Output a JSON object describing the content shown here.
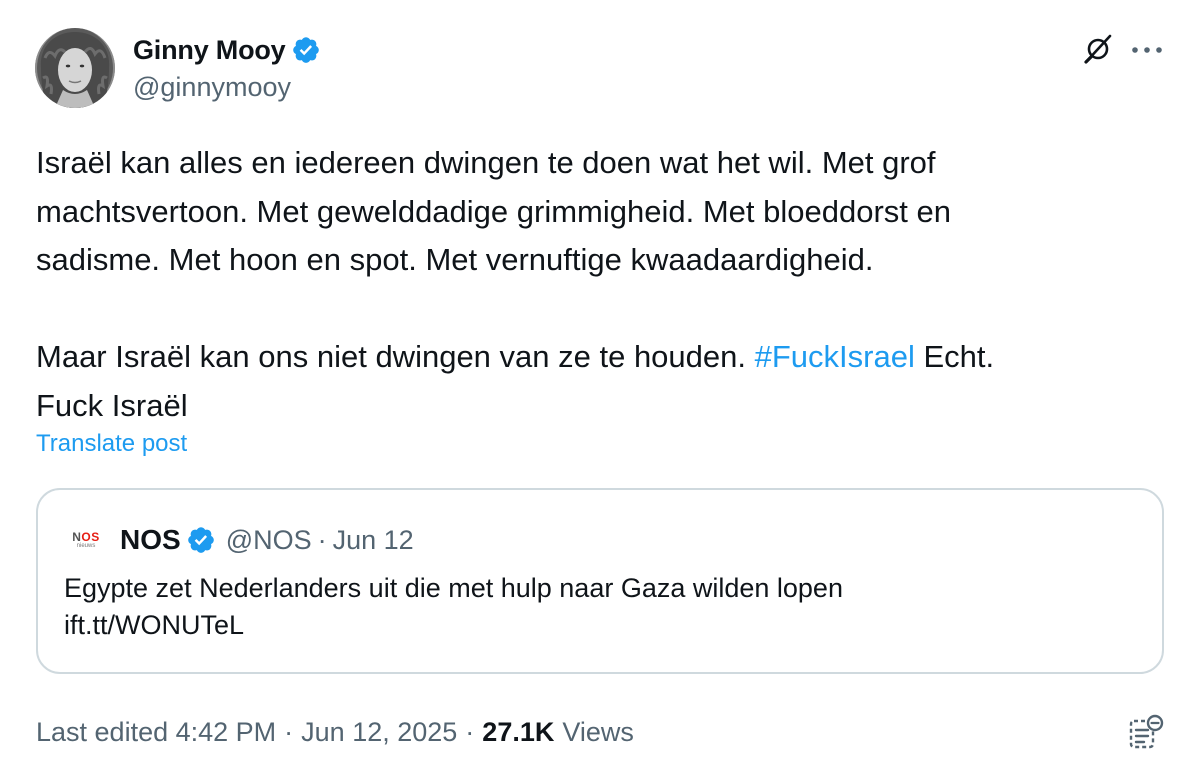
{
  "author": {
    "name": "Ginny Mooy",
    "handle": "@ginnymooy"
  },
  "post": {
    "line1": "Israël kan alles en iedereen dwingen te doen wat het wil. Met grof",
    "line2": "machtsvertoon. Met gewelddadige grimmigheid. Met bloeddorst en",
    "line3": "sadisme. Met hoon en spot. Met vernuftige kwaadaardigheid.",
    "line4_before": "Maar Israël kan ons niet dwingen van ze te houden. ",
    "hashtag": "#FuckIsrael",
    "line4_after": " Echt.",
    "line5": "Fuck Israël"
  },
  "translate_label": "Translate post",
  "quote": {
    "logo_text_main_part1": "N",
    "logo_text_main_part2": "OS",
    "logo_text_sub": "nieuws",
    "name": "NOS",
    "handle": "@NOS",
    "separator": "·",
    "date": "Jun 12",
    "line1": "Egypte zet Nederlanders uit die met hulp naar Gaza wilden lopen",
    "line2": "ift.tt/WONUTeL"
  },
  "meta": {
    "edited_label": "Last edited 4:42 PM",
    "separator": "·",
    "date": "Jun 12, 2025",
    "views_count": "27.1K",
    "views_label": "Views"
  },
  "icons": {
    "verified": "verified-badge-icon",
    "grok": "grok-icon",
    "more": "more-options-icon",
    "bookmark": "bookmark-outline-icon"
  },
  "colors": {
    "link_blue": "#1d9bf0",
    "secondary_text": "#536471",
    "border": "#cfd9de",
    "nos_red": "#e61e14"
  }
}
